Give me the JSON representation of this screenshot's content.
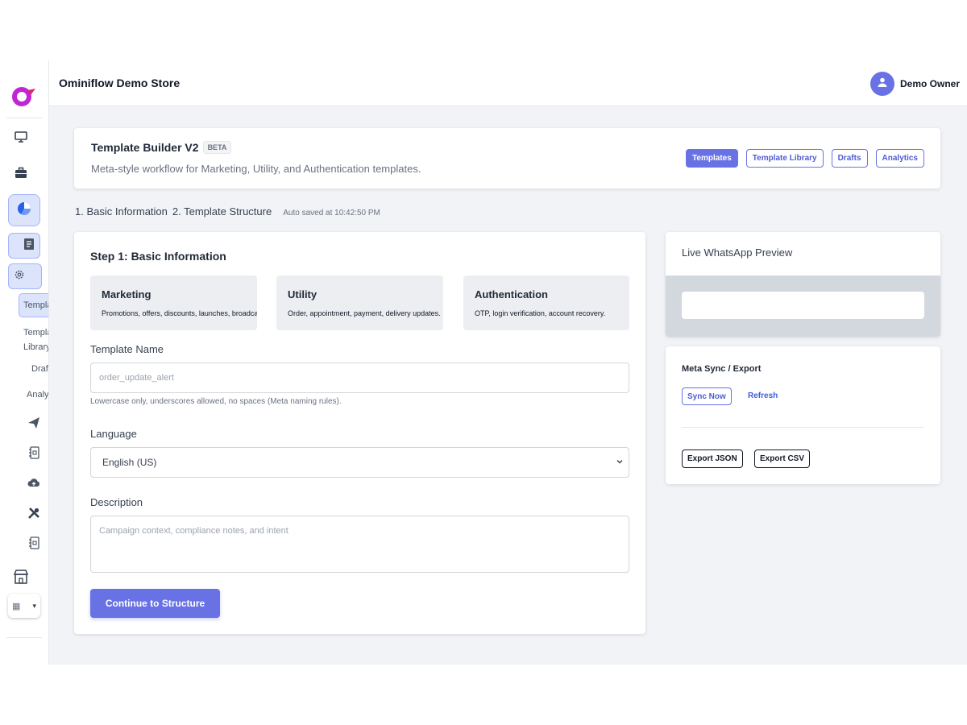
{
  "header": {
    "store_name": "Ominiflow Demo Store",
    "user_name": "Demo Owner"
  },
  "sidebar": {
    "icons": [
      "monitor-icon",
      "briefcase-icon",
      "pie-chart-icon",
      "document-icon",
      "gear-icon",
      "send-icon",
      "contact-book-icon",
      "cloud-upload-icon",
      "tools-icon",
      "contact-book-icon",
      "store-icon"
    ],
    "sub_items": [
      {
        "label": "Templates",
        "active": true
      },
      {
        "label": "Template Library",
        "active": false
      },
      {
        "label": "Drafts",
        "active": false
      },
      {
        "label": "Analytics",
        "active": false
      }
    ],
    "store_select": "▾"
  },
  "page": {
    "title": "Template Builder V2",
    "badge": "BETA",
    "subtitle": "Meta-style workflow for Marketing, Utility, and Authentication templates.",
    "nav": [
      {
        "label": "Templates",
        "active": true
      },
      {
        "label": "Template Library",
        "active": false
      },
      {
        "label": "Drafts",
        "active": false
      },
      {
        "label": "Analytics",
        "active": false
      }
    ]
  },
  "steps": {
    "step1": "1. Basic Information",
    "step2": "2. Template Structure",
    "autosave": "Auto saved at 10:42:50 PM"
  },
  "form": {
    "heading": "Step 1: Basic Information",
    "types": [
      {
        "title": "Marketing",
        "desc": "Promotions, offers, discounts, launches, broadcasts."
      },
      {
        "title": "Utility",
        "desc": "Order, appointment, payment, delivery updates."
      },
      {
        "title": "Authentication",
        "desc": "OTP, login verification, account recovery."
      }
    ],
    "name_label": "Template Name",
    "name_placeholder": "order_update_alert",
    "name_help": "Lowercase only, underscores allowed, no spaces (Meta naming rules).",
    "language_label": "Language",
    "language_value": "English (US)",
    "description_label": "Description",
    "description_placeholder": "Campaign context, compliance notes, and intent",
    "continue_label": "Continue to Structure"
  },
  "preview": {
    "title": "Live WhatsApp Preview"
  },
  "sync": {
    "title": "Meta Sync / Export",
    "sync_now": "Sync Now",
    "refresh": "Refresh",
    "export_json": "Export JSON",
    "export_csv": "Export CSV"
  },
  "colors": {
    "accent": "#6872e5",
    "sidebar_active_bg": "#dbe4fb",
    "logo": "#c026d3"
  }
}
